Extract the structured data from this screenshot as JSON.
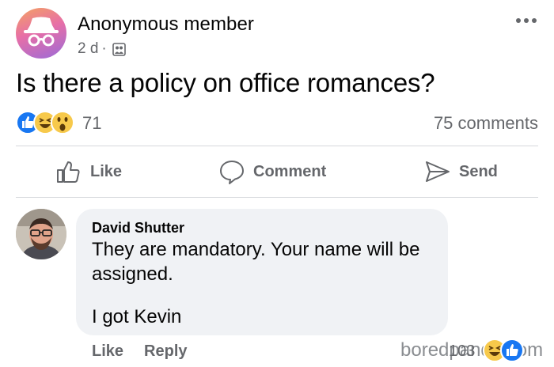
{
  "post": {
    "author": "Anonymous member",
    "time": "2 d",
    "separator": "·",
    "audience_icon": "group-icon",
    "more_icon": "more-dots-icon",
    "text": "Is there a policy on office romances?",
    "reactions": {
      "icons": [
        "like-reaction-icon",
        "haha-reaction-icon",
        "wow-reaction-icon"
      ],
      "count": "71"
    },
    "comments_count": "75 comments"
  },
  "actions": {
    "like": "Like",
    "comment": "Comment",
    "send": "Send"
  },
  "comment": {
    "author": "David Shutter",
    "text_line": "They are mandatory. Your name will be assigned.",
    "text_line2": "I got Kevin",
    "like_label": "Like",
    "reply_label": "Reply",
    "reaction_count": "103",
    "reaction_icons": [
      "haha-reaction-icon",
      "like-reaction-icon"
    ]
  },
  "watermark": "boredpanda.com",
  "colors": {
    "like_blue": "#1877f2",
    "text_secondary": "#65676b",
    "bubble_bg": "#f0f2f5",
    "reaction_yellow": "#f7c94b"
  }
}
